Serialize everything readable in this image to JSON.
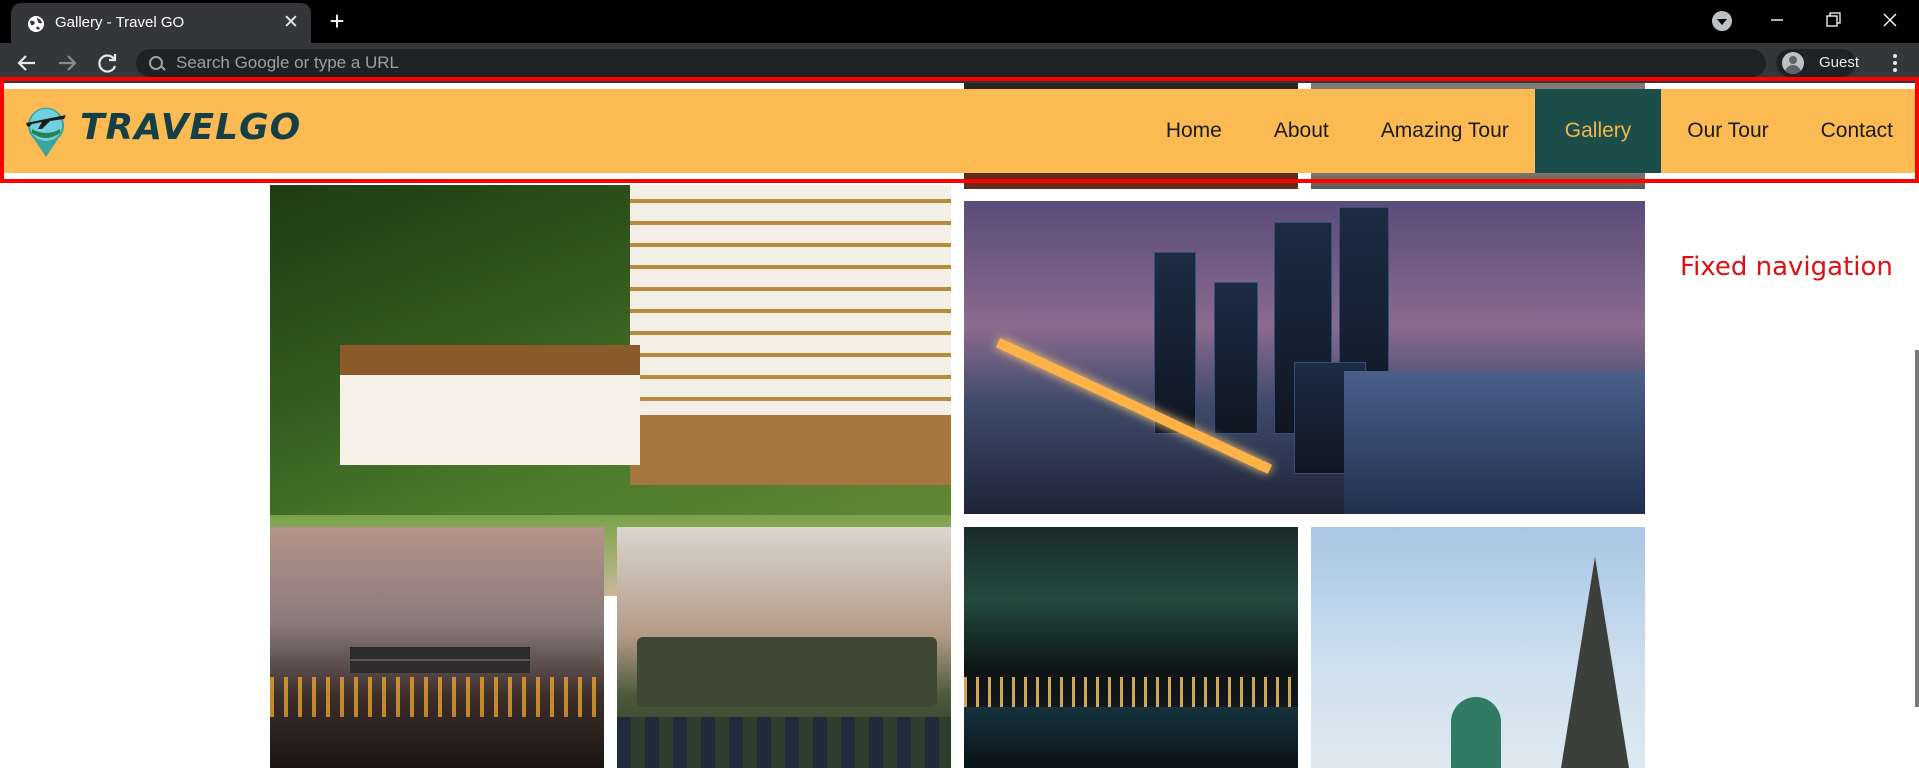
{
  "browser": {
    "tab_title": "Gallery - Travel GO",
    "tab_close_symbol": "✕",
    "new_tab_symbol": "+",
    "address_placeholder": "Search Google or type a URL",
    "profile_label": "Guest",
    "icons": [
      "globe-icon",
      "close-icon",
      "plus-icon",
      "tab-search-icon",
      "minimize-icon",
      "restore-icon",
      "window-close-icon",
      "back-arrow-icon",
      "forward-arrow-icon",
      "reload-icon",
      "search-icon",
      "avatar-icon",
      "kebab-menu-icon"
    ]
  },
  "site": {
    "logo_text": "TRAVELGO",
    "nav": [
      {
        "label": "Home",
        "active": false
      },
      {
        "label": "About",
        "active": false
      },
      {
        "label": "Amazing Tour",
        "active": false
      },
      {
        "label": "Gallery",
        "active": true
      },
      {
        "label": "Our Tour",
        "active": false
      },
      {
        "label": "Contact",
        "active": false
      }
    ],
    "colors": {
      "nav_background": "#fbbb52",
      "nav_active_background": "#1c4d4a",
      "nav_active_text": "#f2b64b",
      "logo_text": "#143f47",
      "highlight": "#ff0000"
    }
  },
  "annotation": {
    "text": "Fixed navigation"
  }
}
